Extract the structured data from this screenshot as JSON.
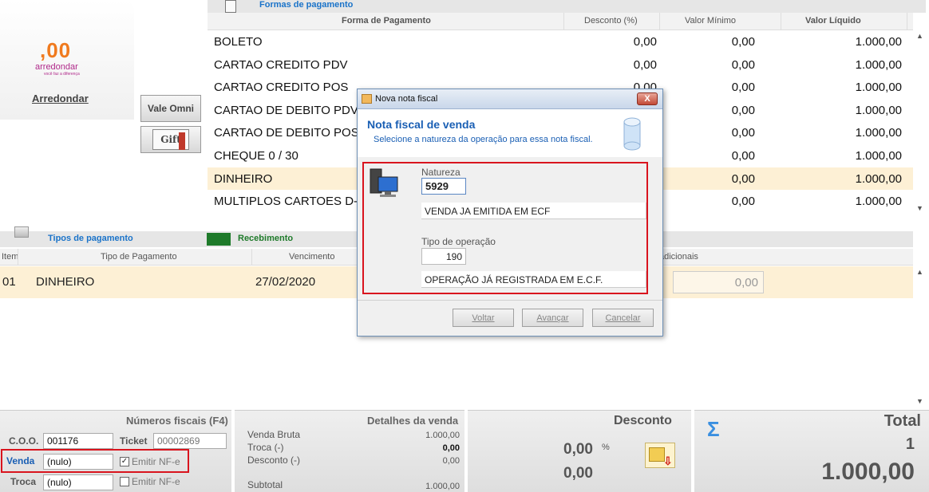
{
  "brand": {
    "logo_number": ",00",
    "logo_name": "arredondar",
    "logo_tagline": "você faz a diferença",
    "round_label": "Arredondar",
    "vale_omni_label": "Vale Omni",
    "gift_card_label": "Gift"
  },
  "formas_pagamento": {
    "title": "Formas de pagamento",
    "headers": {
      "forma": "Forma de Pagamento",
      "desconto": "Desconto (%)",
      "valor_minimo": "Valor Mínimo",
      "valor_liquido": "Valor Líquido"
    },
    "rows": [
      {
        "forma": "BOLETO",
        "desconto": "0,00",
        "minimo": "0,00",
        "liquido": "1.000,00"
      },
      {
        "forma": "CARTAO CREDITO PDV",
        "desconto": "0,00",
        "minimo": "0,00",
        "liquido": "1.000,00"
      },
      {
        "forma": "CARTAO CREDITO POS",
        "desconto": "0,00",
        "minimo": "0,00",
        "liquido": "1.000,00"
      },
      {
        "forma": "CARTAO DE DEBITO PDV",
        "desconto": "0,00",
        "minimo": "0,00",
        "liquido": "1.000,00"
      },
      {
        "forma": "CARTAO DE DEBITO POS",
        "desconto": "0,00",
        "minimo": "0,00",
        "liquido": "1.000,00"
      },
      {
        "forma": "CHEQUE 0 / 30",
        "desconto": "0,00",
        "minimo": "0,00",
        "liquido": "1.000,00"
      },
      {
        "forma": "DINHEIRO",
        "desconto": "0,00",
        "minimo": "0,00",
        "liquido": "1.000,00"
      },
      {
        "forma": "MULTIPLOS CARTOES D-T",
        "desconto": "0,00",
        "minimo": "0,00",
        "liquido": "1.000,00"
      }
    ]
  },
  "tipos_pagamento": {
    "title": "Tipos de pagamento",
    "recebimento_label": "Recebimento",
    "headers": {
      "item": "Item",
      "tipo": "Tipo de Pagamento",
      "vencimento": "Vencimento",
      "adicionais": "adicionais"
    },
    "rows": [
      {
        "item": "01",
        "tipo": "DINHEIRO",
        "vencimento": "27/02/2020",
        "valor": "0,00"
      }
    ]
  },
  "numeros_fiscais": {
    "title": "Números fiscais (F4)",
    "coo_label": "C.O.O.",
    "coo_value": "001176",
    "ticket_label": "Ticket",
    "ticket_value": "00002869",
    "venda_label": "Venda",
    "venda_value": "(nulo)",
    "venda_emitir_label": "Emitir NF-e",
    "troca_label": "Troca",
    "troca_value": "(nulo)",
    "troca_emitir_label": "Emitir NF-e"
  },
  "detalhes_venda": {
    "title": "Detalhes da venda",
    "venda_bruta_label": "Venda Bruta",
    "venda_bruta_value": "1.000,00",
    "troca_label": "Troca (-)",
    "troca_value": "0,00",
    "desconto_label": "Desconto (-)",
    "desconto_value": "0,00",
    "subtotal_label": "Subtotal",
    "subtotal_value": "1.000,00"
  },
  "desconto": {
    "title": "Desconto",
    "percent_value": "0,00",
    "percent_symbol": "%",
    "amount_value": "0,00"
  },
  "total": {
    "title": "Total",
    "sigma": "Σ",
    "count": "1",
    "amount": "1.000,00"
  },
  "modal": {
    "window_title": "Nova nota fiscal",
    "close_glyph": "X",
    "heading": "Nota fiscal de venda",
    "subheading": "Selecione a natureza da operação para essa nota fiscal.",
    "natureza_label": "Natureza",
    "natureza_code": "5929",
    "natureza_desc": "VENDA JA EMITIDA EM ECF",
    "tipo_label": "Tipo de operação",
    "tipo_code": "190",
    "tipo_desc": "OPERAÇÃO JÁ REGISTRADA EM E.C.F.",
    "btn_voltar": "Voltar",
    "btn_avancar": "Avançar",
    "btn_cancelar": "Cancelar"
  },
  "colors": {
    "accent_blue": "#1a73c9",
    "highlight_row": "#fdf0d5",
    "annotation_red": "#d9141e",
    "recebimento_green": "#1e7a2a"
  }
}
